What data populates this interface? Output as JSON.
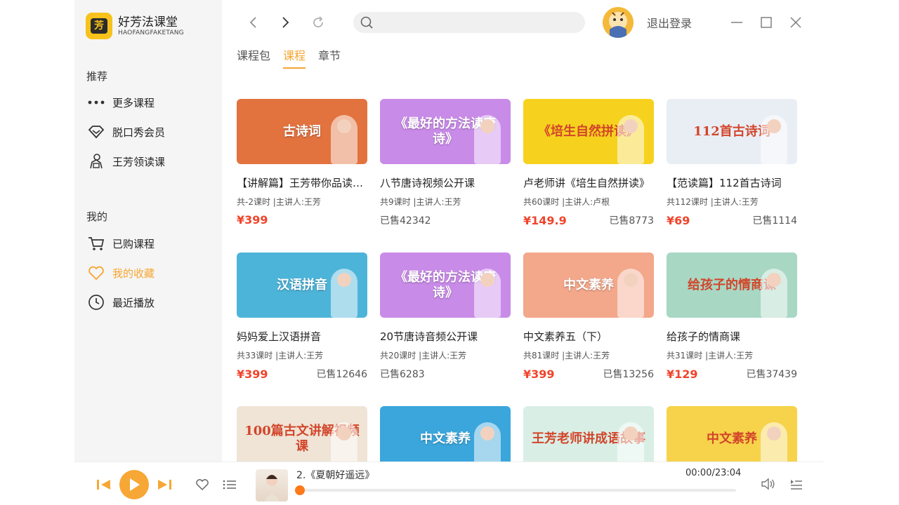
{
  "brand": {
    "title": "好芳法课堂",
    "subtitle": "HAOFANGFAKETANG",
    "mark": "芳",
    "color": "#f7c21b"
  },
  "sidebar": {
    "section_recommend": "推荐",
    "recommend_items": [
      {
        "label": "更多课程",
        "icon": "more-dots-icon"
      },
      {
        "label": "脱口秀会员",
        "icon": "diamond-icon"
      },
      {
        "label": "王芳领读课",
        "icon": "reading-person-icon"
      }
    ],
    "section_mine": "我的",
    "mine_items": [
      {
        "label": "已购课程",
        "icon": "cart-icon",
        "active": false
      },
      {
        "label": "我的收藏",
        "icon": "heart-icon",
        "active": true
      },
      {
        "label": "最近播放",
        "icon": "clock-icon",
        "active": false
      }
    ]
  },
  "topbar": {
    "search_placeholder": "",
    "logout_label": "退出登录"
  },
  "tabs": [
    {
      "label": "课程包",
      "active": false
    },
    {
      "label": "课程",
      "active": true
    },
    {
      "label": "章节",
      "active": false
    }
  ],
  "courses": [
    {
      "title": "【讲解篇】王芳带你品读…",
      "thumb_text": "古诗词",
      "meta": "共-2课时  |主讲人:王芳",
      "price": "¥399",
      "sold": ""
    },
    {
      "title": "八节唐诗视频公开课",
      "thumb_text": "《最好的方法读唐诗》",
      "meta": "共9课时  |主讲人:王芳",
      "price": "",
      "sold": "已售42342"
    },
    {
      "title": "卢老师讲《培生自然拼读》",
      "thumb_text": "《培生自然拼读》",
      "meta": "共60课时  |主讲人:卢根",
      "price": "¥149.9",
      "sold": "已售8773"
    },
    {
      "title": "【范读篇】112首古诗词",
      "thumb_text": "112首古诗词",
      "meta": "共112课时  |主讲人:王芳",
      "price": "¥69",
      "sold": "已售1114"
    },
    {
      "title": "妈妈爱上汉语拼音",
      "thumb_text": "汉语拼音",
      "meta": "共33课时  |主讲人:王芳",
      "price": "¥399",
      "sold": "已售12646"
    },
    {
      "title": "20节唐诗音频公开课",
      "thumb_text": "《最好的方法读唐诗》",
      "meta": "共20课时  |主讲人:王芳",
      "price": "",
      "sold": "已售6283"
    },
    {
      "title": "中文素养五（下）",
      "thumb_text": "中文素养",
      "meta": "共81课时  |主讲人:王芳",
      "price": "¥399",
      "sold": "已售13256"
    },
    {
      "title": "给孩子的情商课",
      "thumb_text": "给孩子的情商课",
      "meta": "共31课时  |主讲人:王芳",
      "price": "¥129",
      "sold": "已售37439"
    },
    {
      "title": "",
      "thumb_text": "100篇古文讲解视频课",
      "meta": "",
      "price": "",
      "sold": ""
    },
    {
      "title": "",
      "thumb_text": "中文素养",
      "meta": "",
      "price": "",
      "sold": ""
    },
    {
      "title": "",
      "thumb_text": "王芳老师讲成语故事",
      "meta": "",
      "price": "",
      "sold": ""
    },
    {
      "title": "",
      "thumb_text": "中文素养",
      "meta": "",
      "price": "",
      "sold": ""
    }
  ],
  "thumb_colors": [
    "#e2733f",
    "#c98be8",
    "#f6d21e",
    "#e9eef5",
    "#4db4d9",
    "#c98be8",
    "#f3a78b",
    "#a8d7c4",
    "#efe4d5",
    "#3aa6dc",
    "#d9efe6",
    "#f6d34a"
  ],
  "player": {
    "track_title": "2.《夏朝好遥远》",
    "time": "00:00/23:04",
    "progress": 0.0
  },
  "colors": {
    "accent": "#f6a531",
    "price": "#f0442b",
    "sidebar_bg": "#f5f5f5"
  }
}
